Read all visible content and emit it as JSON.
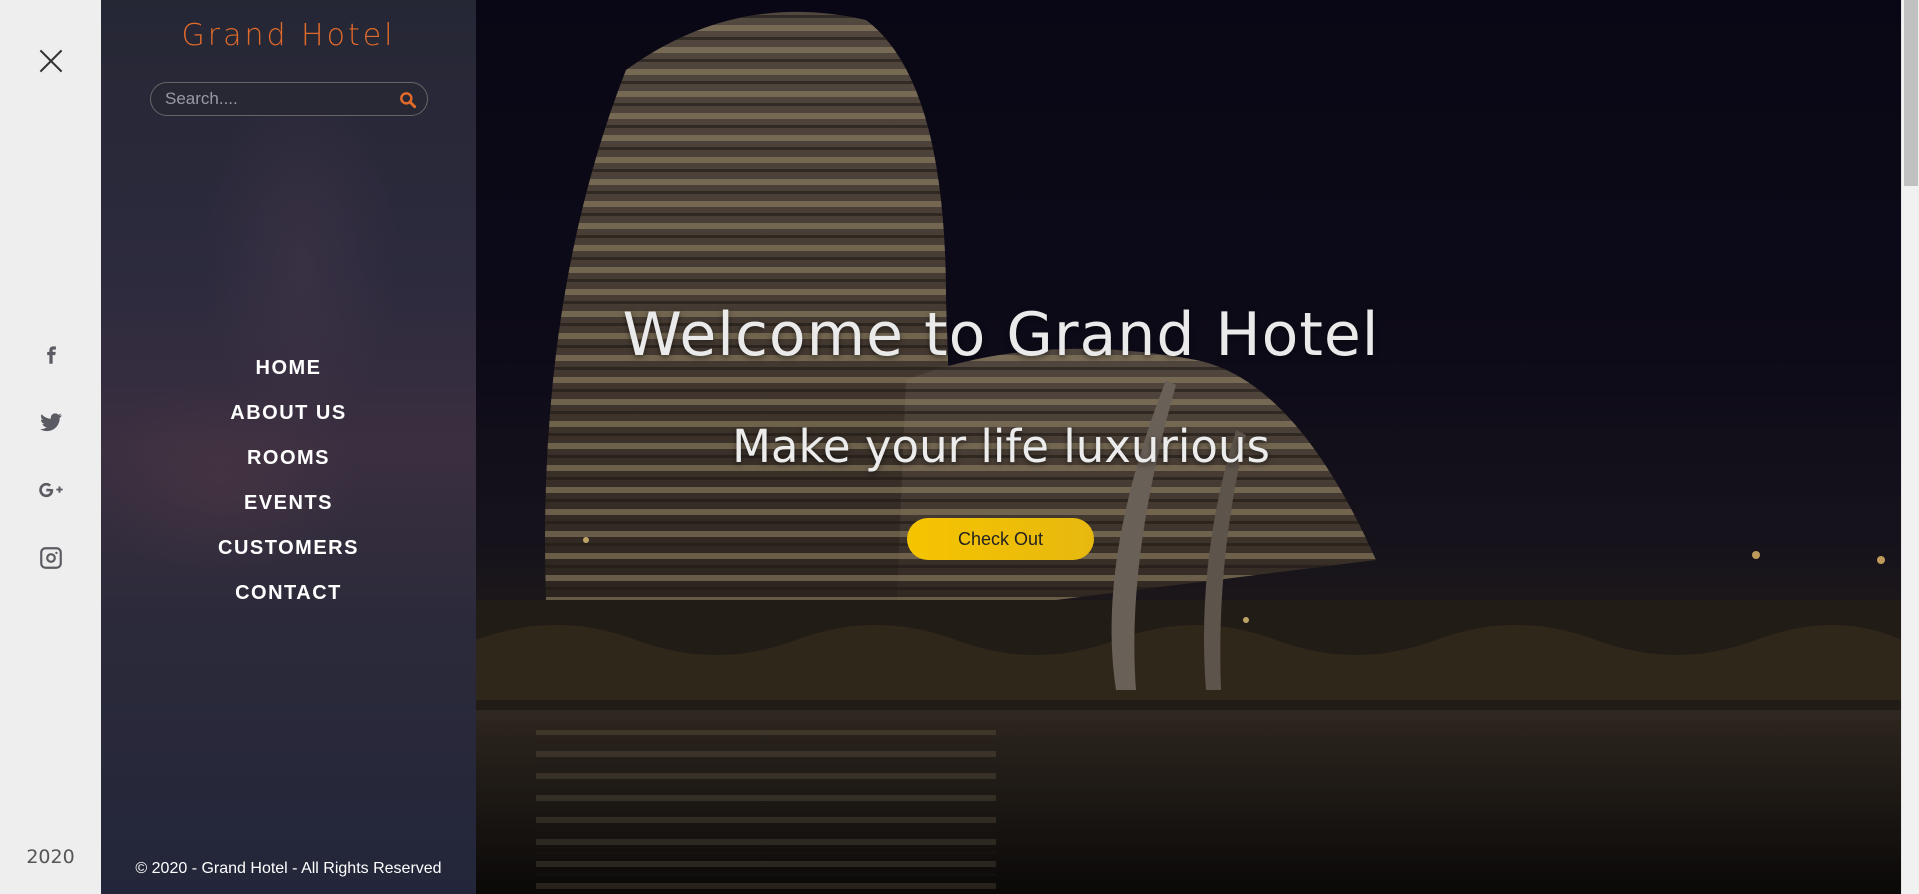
{
  "rail": {
    "close_label": "close",
    "social": [
      {
        "name": "facebook-icon"
      },
      {
        "name": "twitter-icon"
      },
      {
        "name": "google-plus-icon"
      },
      {
        "name": "instagram-icon"
      }
    ],
    "year": "2020"
  },
  "sidebar": {
    "brand": "Grand Hotel",
    "search_placeholder": "Search....",
    "nav": [
      "HOME",
      "ABOUT US",
      "ROOMS",
      "EVENTS",
      "CUSTOMERS",
      "CONTACT"
    ],
    "copyright": "© 2020 - Grand Hotel - All Rights Reserved"
  },
  "hero": {
    "title": "Welcome to Grand Hotel",
    "subtitle": "Make your life luxurious",
    "cta_label": "Check Out"
  },
  "colors": {
    "brand": "#e06a2a",
    "accent": "#f5c400",
    "sidebar_bg": "#2a2a3a"
  }
}
